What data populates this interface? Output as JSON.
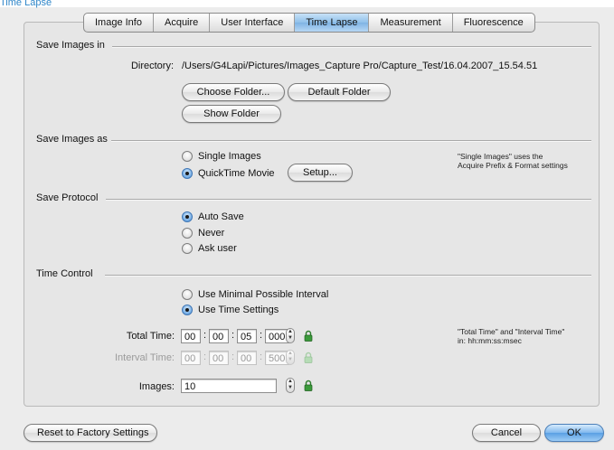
{
  "window": {
    "title_fragment": "Time Lapse"
  },
  "tabs": [
    "Image Info",
    "Acquire",
    "User Interface",
    "Time Lapse",
    "Measurement",
    "Fluorescence"
  ],
  "active_tab": "Time Lapse",
  "save_images_in": {
    "heading": "Save Images in",
    "directory_label": "Directory:",
    "directory_value": "/Users/G4Lapi/Pictures/Images_Capture Pro/Capture_Test/16.04.2007_15.54.51",
    "choose_folder": "Choose Folder...",
    "default_folder": "Default Folder",
    "show_folder": "Show Folder"
  },
  "save_images_as": {
    "heading": "Save Images as",
    "opt_single": "Single Images",
    "opt_quicktime": "QuickTime Movie",
    "selected": "QuickTime Movie",
    "setup": "Setup...",
    "note_line1": "\"Single Images\" uses the",
    "note_line2": "Acquire Prefix & Format settings"
  },
  "save_protocol": {
    "heading": "Save Protocol",
    "opt_auto": "Auto Save",
    "opt_never": "Never",
    "opt_ask": "Ask user",
    "selected": "Auto Save"
  },
  "time_control": {
    "heading": "Time Control",
    "opt_minimal": "Use Minimal Possible Interval",
    "opt_settings": "Use Time Settings",
    "selected": "Use Time Settings",
    "total_label": "Total Time:",
    "total": [
      "00",
      "00",
      "05",
      "000"
    ],
    "interval_label": "Interval Time:",
    "interval": [
      "00",
      "00",
      "00",
      "500"
    ],
    "images_label": "Images:",
    "images_value": "10",
    "note_line1": "\"Total Time\" and \"Interval Time\"",
    "note_line2": "in: hh:mm:ss:msec"
  },
  "footer": {
    "reset": "Reset to Factory Settings",
    "cancel": "Cancel",
    "ok": "OK"
  },
  "colors": {
    "accent": "#5a9fe3",
    "lock": "#2e8b2e"
  }
}
